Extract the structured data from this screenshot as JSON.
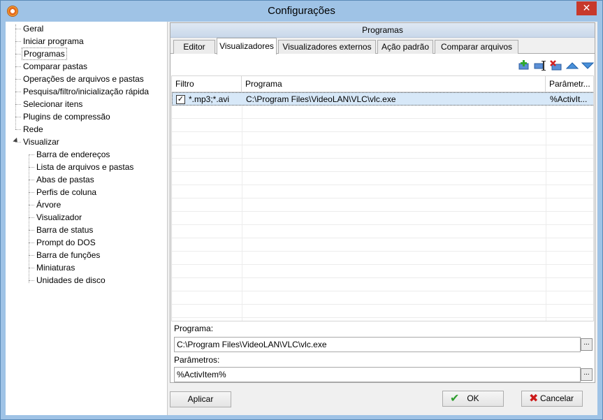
{
  "window": {
    "title": "Configurações"
  },
  "tree": {
    "items": [
      {
        "label": "Geral"
      },
      {
        "label": "Iniciar programa"
      },
      {
        "label": "Programas"
      },
      {
        "label": "Comparar pastas"
      },
      {
        "label": "Operações de arquivos e pastas"
      },
      {
        "label": "Pesquisa/filtro/inicialização rápida"
      },
      {
        "label": "Selecionar itens"
      },
      {
        "label": "Plugins de compressão"
      },
      {
        "label": "Rede"
      },
      {
        "label": "Visualizar"
      }
    ],
    "children": [
      {
        "label": "Barra de endereços"
      },
      {
        "label": "Lista de arquivos e pastas"
      },
      {
        "label": "Abas de pastas"
      },
      {
        "label": "Perfis de coluna"
      },
      {
        "label": "Árvore"
      },
      {
        "label": "Visualizador"
      },
      {
        "label": "Barra de status"
      },
      {
        "label": "Prompt do DOS"
      },
      {
        "label": "Barra de funções"
      },
      {
        "label": "Miniaturas"
      },
      {
        "label": "Unidades de disco"
      }
    ]
  },
  "panel": {
    "title": "Programas",
    "tabs": [
      {
        "label": "Editor"
      },
      {
        "label": "Visualizadores"
      },
      {
        "label": "Visualizadores externos"
      },
      {
        "label": "Ação padrão"
      },
      {
        "label": "Comparar arquivos"
      }
    ],
    "toolbar": {
      "icons": [
        "add-icon",
        "edit-icon",
        "delete-icon",
        "move-up-icon",
        "move-down-icon"
      ]
    },
    "table": {
      "columns": [
        "Filtro",
        "Programa",
        "Parâmetr..."
      ],
      "rows": [
        {
          "checked": true,
          "filter": "*.mp3;*.avi",
          "program": "C:\\Program Files\\VideoLAN\\VLC\\vlc.exe",
          "params": "%ActivIt..."
        }
      ]
    },
    "program_label": "Programa:",
    "program_value": "C:\\Program Files\\VideoLAN\\VLC\\vlc.exe",
    "params_label": "Parâmetros:",
    "params_value": "%ActivItem%",
    "browse_label": "..."
  },
  "buttons": {
    "apply": "Aplicar",
    "ok": "OK",
    "cancel": "Cancelar"
  },
  "colors": {
    "titlebar": "#9fc3e6",
    "ok_icon": "#2e9e2e",
    "cancel_icon": "#cc1a1a",
    "close_button": "#c7392b"
  }
}
